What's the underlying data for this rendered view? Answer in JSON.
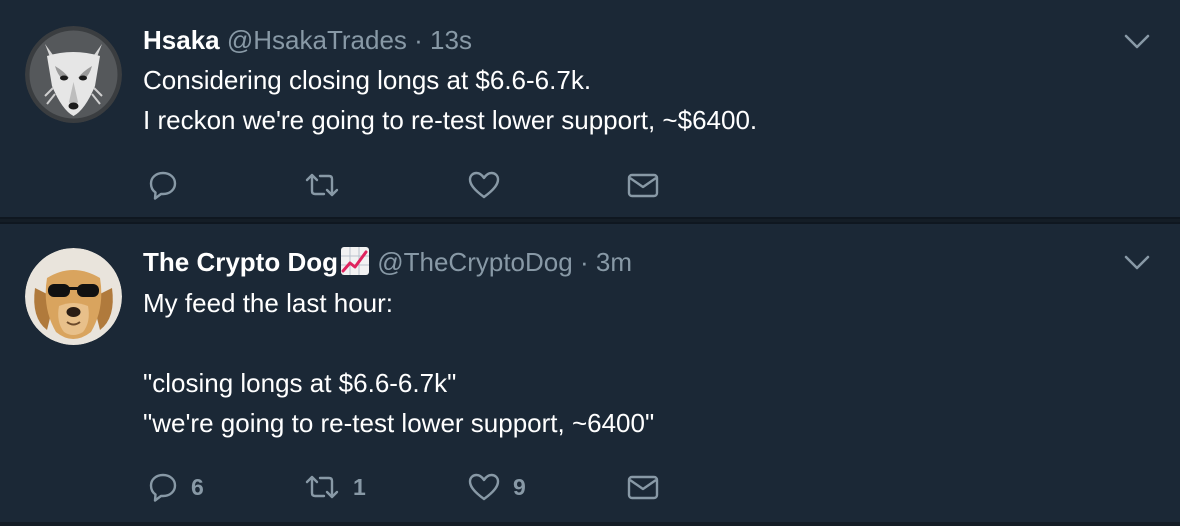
{
  "tweets": [
    {
      "display_name": "Hsaka",
      "handle": "@HsakaTrades",
      "separator": "·",
      "time": "13s",
      "text": "Considering closing longs at $6.6-6.7k.\nI reckon we're going to re-test lower support, ~$6400.",
      "avatar_icon": "wolf-avatar",
      "actions": {
        "reply_count": "",
        "retweet_count": "",
        "like_count": ""
      }
    },
    {
      "display_name": "The Crypto Dog",
      "name_emoji": "chart-increasing-emoji",
      "handle": "@TheCryptoDog",
      "separator": "·",
      "time": "3m",
      "text": "My feed the last hour:\n\n\"closing longs at $6.6-6.7k\"\n\"we're going to re-test lower support, ~6400\"",
      "avatar_icon": "dog-with-sunglasses-avatar",
      "actions": {
        "reply_count": "6",
        "retweet_count": "1",
        "like_count": "9"
      }
    }
  ],
  "colors": {
    "background": "#141d26",
    "card": "#1b2836",
    "text": "#ffffff",
    "muted": "#8899a6",
    "divider": "#0f1720"
  }
}
